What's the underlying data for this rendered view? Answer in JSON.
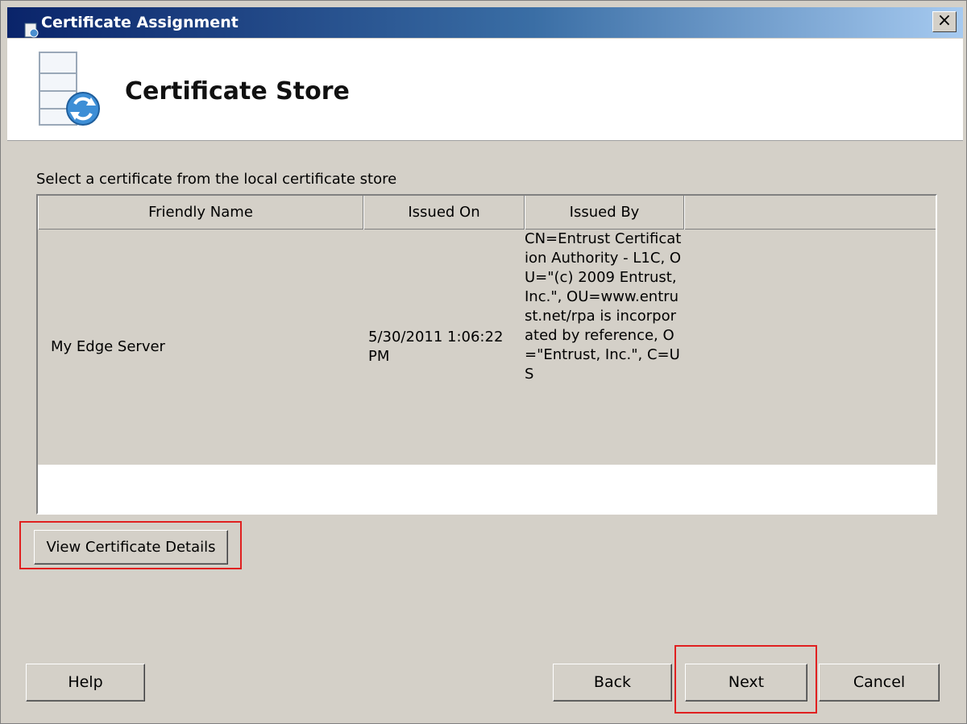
{
  "window": {
    "title": "Certificate Assignment",
    "close_label": "×"
  },
  "header": {
    "title": "Certificate Store",
    "icon": "server-certificate-icon"
  },
  "instruction": "Select a certificate from the local certificate store",
  "table": {
    "columns": [
      "Friendly Name",
      "Issued On",
      "Issued By",
      ""
    ],
    "rows": [
      {
        "friendly_name": "My Edge Server",
        "issued_on": "5/30/2011 1:06:22 PM",
        "issued_by": "CN=Entrust Certification Authority - L1C, OU=\"(c) 2009 Entrust, Inc.\", OU=www.entrust.net/rpa is incorporated by reference, O=\"Entrust, Inc.\", C=US"
      }
    ]
  },
  "buttons": {
    "view_details": "View Certificate Details",
    "help": "Help",
    "back": "Back",
    "next": "Next",
    "cancel": "Cancel"
  },
  "colors": {
    "highlight": "#e02020",
    "titlebar_start": "#0a246a",
    "titlebar_end": "#a6caf0",
    "dialog_background": "#d4d0c8"
  }
}
